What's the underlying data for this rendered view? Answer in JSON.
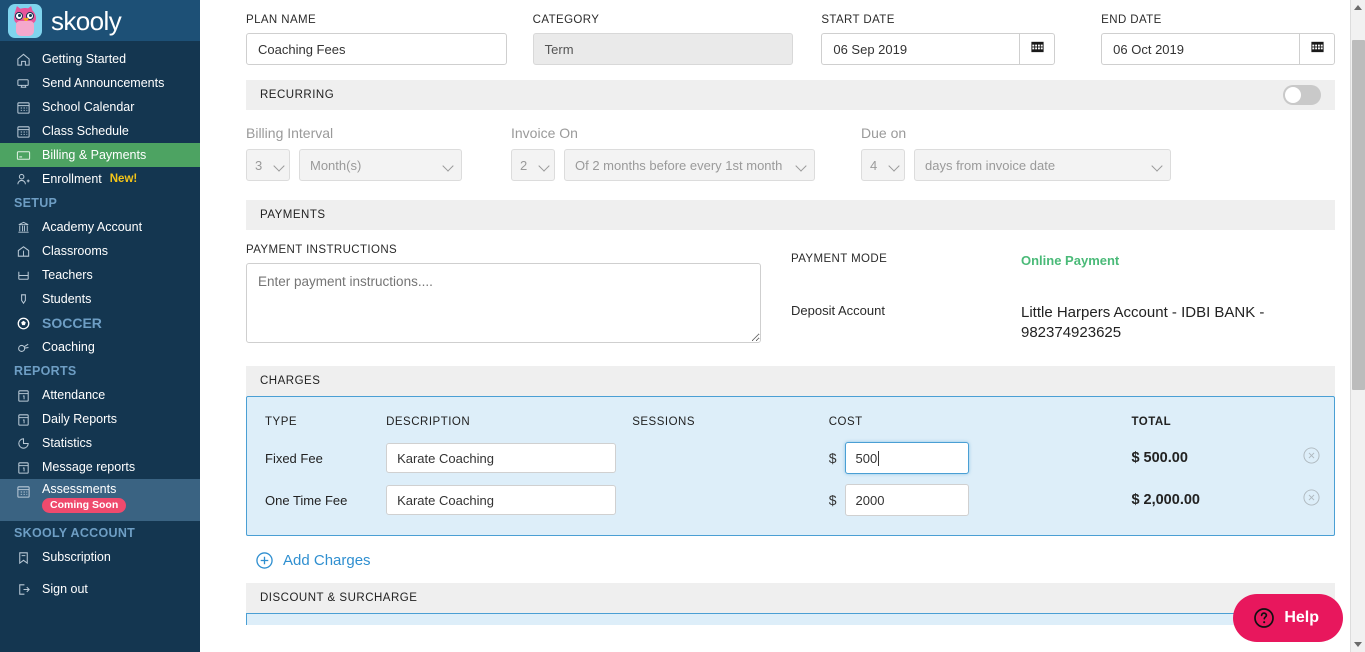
{
  "brand": {
    "name": "skooly",
    "logo_icon": "owl-logo-icon",
    "sidebar_bg": "#143650",
    "logo_bar_bg": "#1d5076",
    "active_green": "#4da362",
    "accent_blue": "#2f8fd0",
    "help_pink": "#e8175d"
  },
  "sidebar": {
    "items": [
      {
        "label": "Getting Started",
        "icon": "home-icon",
        "state": "normal"
      },
      {
        "label": "Send Announcements",
        "icon": "announcement-icon",
        "state": "normal"
      },
      {
        "label": "School Calendar",
        "icon": "calendar-icon",
        "state": "normal"
      },
      {
        "label": "Class Schedule",
        "icon": "calendar-icon",
        "state": "normal"
      },
      {
        "label": "Billing & Payments",
        "icon": "billing-card-icon",
        "state": "active"
      },
      {
        "label": "Enrollment",
        "icon": "user-plus-icon",
        "state": "normal",
        "badge": "New!"
      }
    ],
    "section_setup": "SETUP",
    "setup_items": [
      {
        "label": "Academy Account",
        "icon": "academy-icon"
      },
      {
        "label": "Classrooms",
        "icon": "classroom-icon"
      },
      {
        "label": "Teachers",
        "icon": "teacher-icon"
      },
      {
        "label": "Students",
        "icon": "student-icon"
      }
    ],
    "soccer": {
      "label": "SOCCER",
      "icon": "soccer-ball-icon"
    },
    "coaching": {
      "label": "Coaching",
      "icon": "whistle-icon"
    },
    "section_reports": "REPORTS",
    "report_items": [
      {
        "label": "Attendance",
        "icon": "calendar-day-icon"
      },
      {
        "label": "Daily Reports",
        "icon": "calendar-day-icon"
      },
      {
        "label": "Statistics",
        "icon": "pie-chart-icon"
      },
      {
        "label": "Message reports",
        "icon": "calendar-day-icon"
      }
    ],
    "assessments": {
      "label": "Assessments",
      "icon": "grid-calendar-icon",
      "badge": "Coming Soon",
      "state": "highlighted"
    },
    "section_account": "SKOOLY ACCOUNT",
    "account_items": [
      {
        "label": "Subscription",
        "icon": "bookmark-icon"
      },
      {
        "label": "Sign out",
        "icon": "sign-out-icon"
      }
    ]
  },
  "form": {
    "plan_name": {
      "label": "PLAN NAME",
      "value": "Coaching Fees",
      "placeholder": ""
    },
    "category": {
      "label": "CATEGORY",
      "value": "Term",
      "disabled": true
    },
    "start_date": {
      "label": "START DATE",
      "value": "06 Sep 2019",
      "icon": "calendar-icon"
    },
    "end_date": {
      "label": "END DATE",
      "value": "06 Oct 2019",
      "icon": "calendar-icon"
    }
  },
  "recurring": {
    "section_title": "RECURRING",
    "toggle_state": "off",
    "billing_interval": {
      "label": "Billing Interval",
      "count": "3",
      "unit": "Month(s)"
    },
    "invoice_on": {
      "label": "Invoice On",
      "count": "2",
      "rule": "Of 2 months before every 1st month"
    },
    "due_on": {
      "label": "Due on",
      "count": "4",
      "rule": "days from invoice date"
    }
  },
  "payments": {
    "section_title": "PAYMENTS",
    "instructions_label": "PAYMENT INSTRUCTIONS",
    "instructions_placeholder": "Enter payment instructions....",
    "instructions_value": "",
    "payment_mode_label": "PAYMENT MODE",
    "payment_mode_value": "Online Payment",
    "deposit_account_label": "Deposit Account",
    "deposit_account_value": "Little Harpers Account - IDBI BANK - 982374923625"
  },
  "charges": {
    "section_title": "CHARGES",
    "columns": [
      "TYPE",
      "DESCRIPTION",
      "SESSIONS",
      "COST",
      "TOTAL"
    ],
    "currency_symbol": "$",
    "rows": [
      {
        "type": "Fixed Fee",
        "description": "Karate Coaching",
        "sessions": "",
        "cost": "500",
        "total": "$ 500.00",
        "focused": true,
        "remove_icon": "remove-circle-icon"
      },
      {
        "type": "One Time Fee",
        "description": "Karate Coaching",
        "sessions": "",
        "cost": "2000",
        "total": "$ 2,000.00",
        "focused": false,
        "remove_icon": "remove-circle-icon"
      }
    ],
    "add_label": "Add Charges",
    "add_icon": "plus-circle-icon"
  },
  "discount": {
    "section_title": "DISCOUNT & SURCHARGE"
  },
  "help": {
    "label": "Help",
    "icon": "question-circle-icon"
  }
}
